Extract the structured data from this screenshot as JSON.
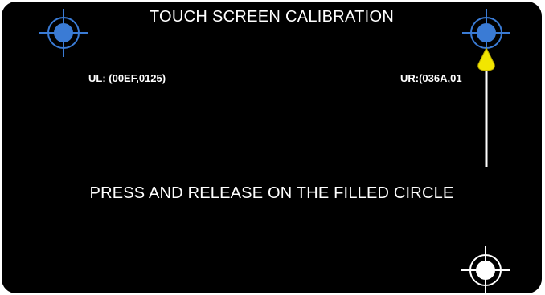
{
  "screen": {
    "title": "TOUCH SCREEN CALIBRATION",
    "instruction": "PRESS AND RELEASE ON THE FILLED CIRCLE",
    "coordinates": {
      "upper_left": "UL: (00EF,0125)",
      "upper_right": "UR:(036A,01"
    }
  },
  "targets": [
    {
      "id": "upper-left",
      "state": "calibrated",
      "fill_color": "#3a7bd5"
    },
    {
      "id": "upper-right",
      "state": "calibrated",
      "fill_color": "#3a7bd5"
    },
    {
      "id": "lower-right",
      "state": "active",
      "fill_color": "#ffffff"
    }
  ],
  "colors": {
    "background": "#000000",
    "text": "#ffffff",
    "crosshair_calibrated": "#3a7bd5",
    "crosshair_active": "#ffffff",
    "pointer": "#f2e600"
  },
  "icons": {
    "target": "crosshair-target-icon",
    "pointer": "arrow-pointer-icon"
  }
}
